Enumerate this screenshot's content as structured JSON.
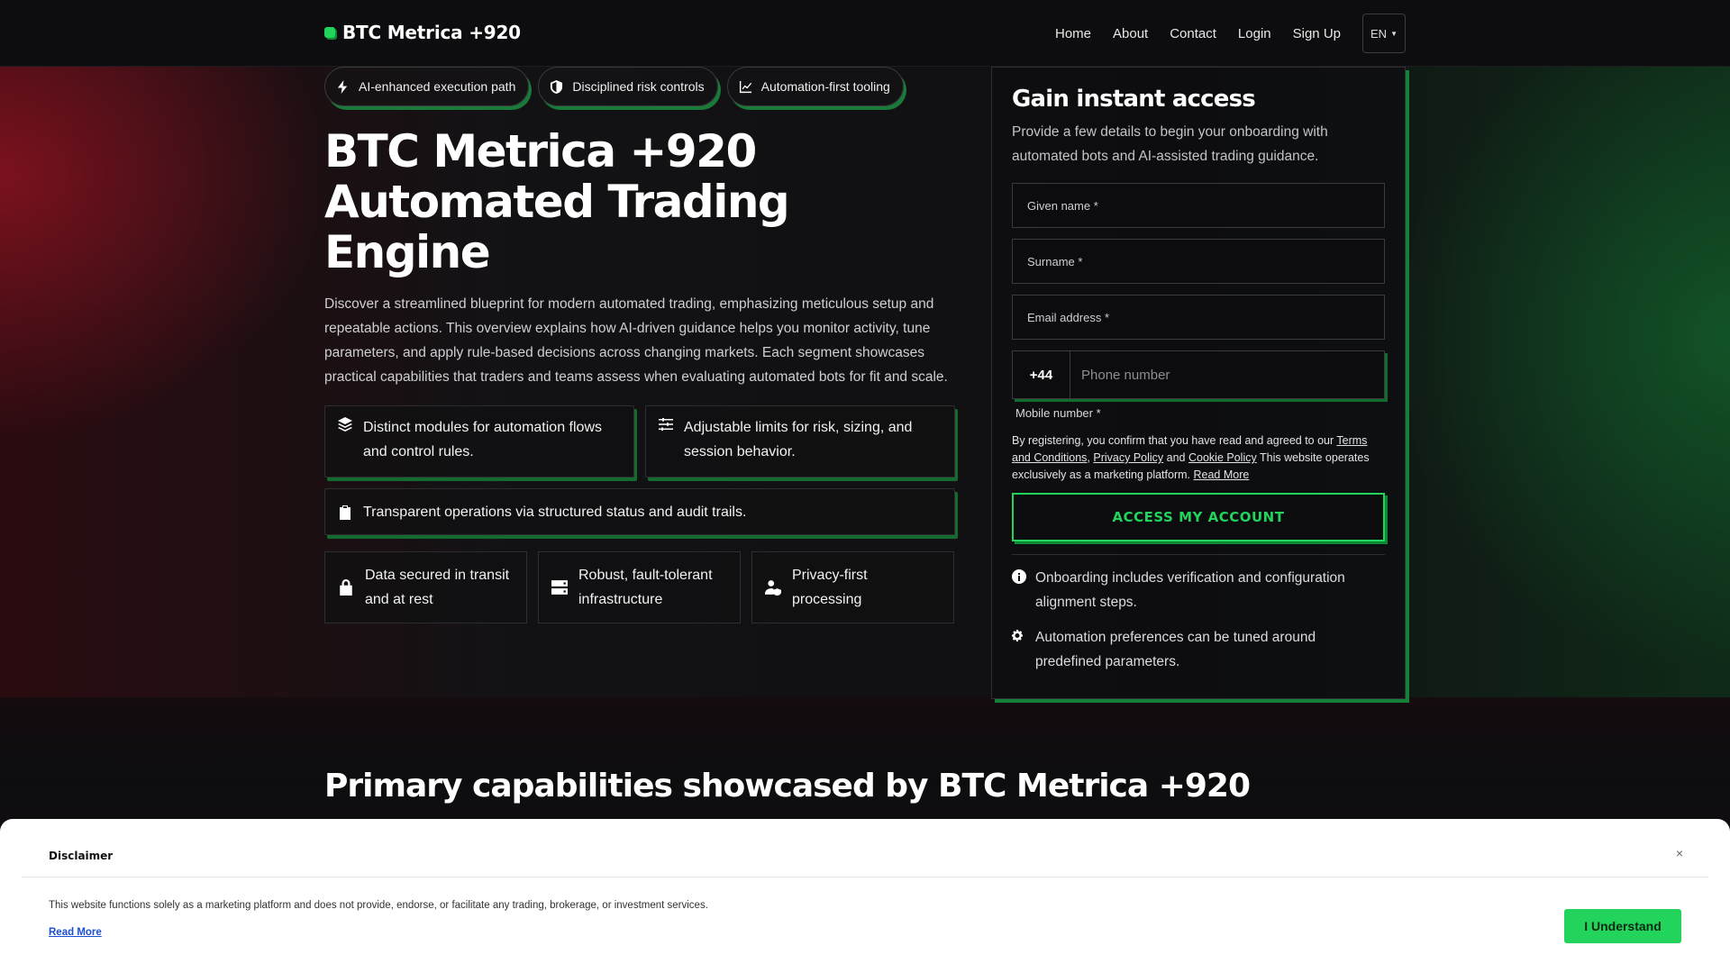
{
  "brand": {
    "name": "BTC Metrica +920",
    "accent": "#22d35c"
  },
  "nav": {
    "links": [
      "Home",
      "About",
      "Contact",
      "Login",
      "Sign Up"
    ],
    "language": "EN"
  },
  "hero": {
    "chips": [
      {
        "icon": "lightning-icon",
        "label": "AI-enhanced execution path"
      },
      {
        "icon": "shield-icon",
        "label": "Disciplined risk controls"
      },
      {
        "icon": "trend-chart-icon",
        "label": "Automation-first tooling"
      }
    ],
    "title": "BTC Metrica +920 Automated Trading Engine",
    "description": "Discover a streamlined blueprint for modern automated trading, emphasizing meticulous setup and repeatable actions. This overview explains how AI-driven guidance helps you monitor activity, tune parameters, and apply rule-based decisions across changing markets. Each segment showcases practical capabilities that traders and teams assess when evaluating automated bots for fit and scale.",
    "features": [
      {
        "icon": "layers-icon",
        "text": "Distinct modules for automation flows and control rules."
      },
      {
        "icon": "sliders-icon",
        "text": "Adjustable limits for risk, sizing, and session behavior."
      },
      {
        "icon": "clipboard-check-icon",
        "text": "Transparent operations via structured status and audit trails."
      }
    ],
    "trust": [
      {
        "icon": "lock-icon",
        "text": "Data secured in transit and at rest"
      },
      {
        "icon": "server-icon",
        "text": "Robust, fault-tolerant infrastructure"
      },
      {
        "icon": "user-shield-icon",
        "text": "Privacy-first processing"
      }
    ]
  },
  "form": {
    "title": "Gain instant access",
    "subtitle": "Provide a few details to begin your onboarding with automated bots and AI-assisted trading guidance.",
    "given_name_placeholder": "Given name *",
    "surname_placeholder": "Surname *",
    "email_placeholder": "Email address *",
    "phone_code": "+44",
    "phone_placeholder": "Phone number",
    "phone_label": "Mobile number *",
    "legal": {
      "prefix": "By registering, you confirm that you have read and agreed to our",
      "terms": "Terms and Conditions",
      "sep1": ",",
      "privacy": "Privacy Policy",
      "and": "and",
      "cookie": "Cookie Policy",
      "suffix": "This website operates exclusively as a marketing platform.",
      "read_more": "Read More"
    },
    "submit": "ACCESS MY ACCOUNT",
    "notes": [
      {
        "icon": "info-icon",
        "text": "Onboarding includes verification and configuration alignment steps."
      },
      {
        "icon": "gears-icon",
        "text": "Automation preferences can be tuned around predefined parameters."
      }
    ]
  },
  "capabilities": {
    "title": "Primary capabilities showcased by BTC Metrica +920"
  },
  "disclaimer": {
    "title": "Disclaimer",
    "close": "×",
    "text": "This website functions solely as a marketing platform and does not provide, endorse, or facilitate any trading, brokerage, or investment services.",
    "read_more": "Read More",
    "button": "I Understand"
  }
}
